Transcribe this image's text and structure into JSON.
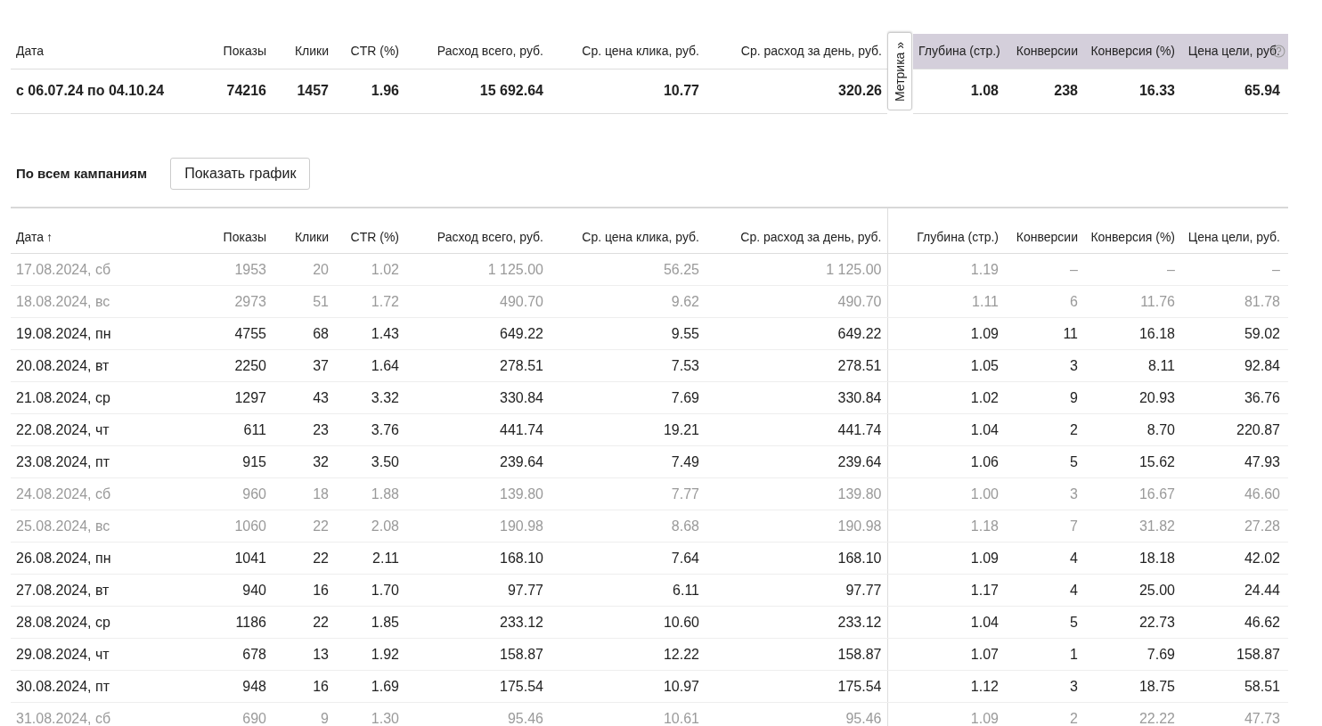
{
  "summary": {
    "columns": [
      "Дата",
      "Показы",
      "Клики",
      "CTR (%)",
      "Расход всего, руб.",
      "Ср. цена клика, руб.",
      "Ср. расход за день, руб."
    ],
    "values": [
      "с 06.07.24 по 04.10.24",
      "74216",
      "1457",
      "1.96",
      "15 692.64",
      "10.77",
      "320.26"
    ],
    "metrika": {
      "tab_label": "Метрика »",
      "columns": [
        "Глубина (стр.)",
        "Конверсии",
        "Конверсия (%)",
        "Цена цели, руб."
      ],
      "values": [
        "1.08",
        "238",
        "16.33",
        "65.94"
      ]
    }
  },
  "section": {
    "title": "По всем кампаниям",
    "button": "Показать график"
  },
  "table": {
    "columns": [
      {
        "label": "Дата",
        "sort_arrow": "↑"
      },
      {
        "label": "Показы"
      },
      {
        "label": "Клики"
      },
      {
        "label": "CTR (%)"
      },
      {
        "label": "Расход всего, руб."
      },
      {
        "label": "Ср. цена клика, руб."
      },
      {
        "label": "Ср. расход за день, руб."
      },
      {
        "label": "Глубина (стр.)"
      },
      {
        "label": "Конверсии"
      },
      {
        "label": "Конверсия (%)"
      },
      {
        "label": "Цена цели, руб."
      }
    ],
    "rows": [
      {
        "weekend": true,
        "cells": [
          "17.08.2024, сб",
          "1953",
          "20",
          "1.02",
          "1 125.00",
          "56.25",
          "1 125.00",
          "1.19",
          "–",
          "–",
          "–"
        ]
      },
      {
        "weekend": true,
        "cells": [
          "18.08.2024, вс",
          "2973",
          "51",
          "1.72",
          "490.70",
          "9.62",
          "490.70",
          "1.11",
          "6",
          "11.76",
          "81.78"
        ]
      },
      {
        "weekend": false,
        "cells": [
          "19.08.2024, пн",
          "4755",
          "68",
          "1.43",
          "649.22",
          "9.55",
          "649.22",
          "1.09",
          "11",
          "16.18",
          "59.02"
        ]
      },
      {
        "weekend": false,
        "cells": [
          "20.08.2024, вт",
          "2250",
          "37",
          "1.64",
          "278.51",
          "7.53",
          "278.51",
          "1.05",
          "3",
          "8.11",
          "92.84"
        ]
      },
      {
        "weekend": false,
        "cells": [
          "21.08.2024, ср",
          "1297",
          "43",
          "3.32",
          "330.84",
          "7.69",
          "330.84",
          "1.02",
          "9",
          "20.93",
          "36.76"
        ]
      },
      {
        "weekend": false,
        "cells": [
          "22.08.2024, чт",
          "611",
          "23",
          "3.76",
          "441.74",
          "19.21",
          "441.74",
          "1.04",
          "2",
          "8.70",
          "220.87"
        ]
      },
      {
        "weekend": false,
        "cells": [
          "23.08.2024, пт",
          "915",
          "32",
          "3.50",
          "239.64",
          "7.49",
          "239.64",
          "1.06",
          "5",
          "15.62",
          "47.93"
        ]
      },
      {
        "weekend": true,
        "cells": [
          "24.08.2024, сб",
          "960",
          "18",
          "1.88",
          "139.80",
          "7.77",
          "139.80",
          "1.00",
          "3",
          "16.67",
          "46.60"
        ]
      },
      {
        "weekend": true,
        "cells": [
          "25.08.2024, вс",
          "1060",
          "22",
          "2.08",
          "190.98",
          "8.68",
          "190.98",
          "1.18",
          "7",
          "31.82",
          "27.28"
        ]
      },
      {
        "weekend": false,
        "cells": [
          "26.08.2024, пн",
          "1041",
          "22",
          "2.11",
          "168.10",
          "7.64",
          "168.10",
          "1.09",
          "4",
          "18.18",
          "42.02"
        ]
      },
      {
        "weekend": false,
        "cells": [
          "27.08.2024, вт",
          "940",
          "16",
          "1.70",
          "97.77",
          "6.11",
          "97.77",
          "1.17",
          "4",
          "25.00",
          "24.44"
        ]
      },
      {
        "weekend": false,
        "cells": [
          "28.08.2024, ср",
          "1186",
          "22",
          "1.85",
          "233.12",
          "10.60",
          "233.12",
          "1.04",
          "5",
          "22.73",
          "46.62"
        ]
      },
      {
        "weekend": false,
        "cells": [
          "29.08.2024, чт",
          "678",
          "13",
          "1.92",
          "158.87",
          "12.22",
          "158.87",
          "1.07",
          "1",
          "7.69",
          "158.87"
        ]
      },
      {
        "weekend": false,
        "cells": [
          "30.08.2024, пт",
          "948",
          "16",
          "1.69",
          "175.54",
          "10.97",
          "175.54",
          "1.12",
          "3",
          "18.75",
          "58.51"
        ]
      },
      {
        "weekend": true,
        "cells": [
          "31.08.2024, сб",
          "690",
          "9",
          "1.30",
          "95.46",
          "10.61",
          "95.46",
          "1.09",
          "2",
          "22.22",
          "47.73"
        ]
      }
    ]
  }
}
